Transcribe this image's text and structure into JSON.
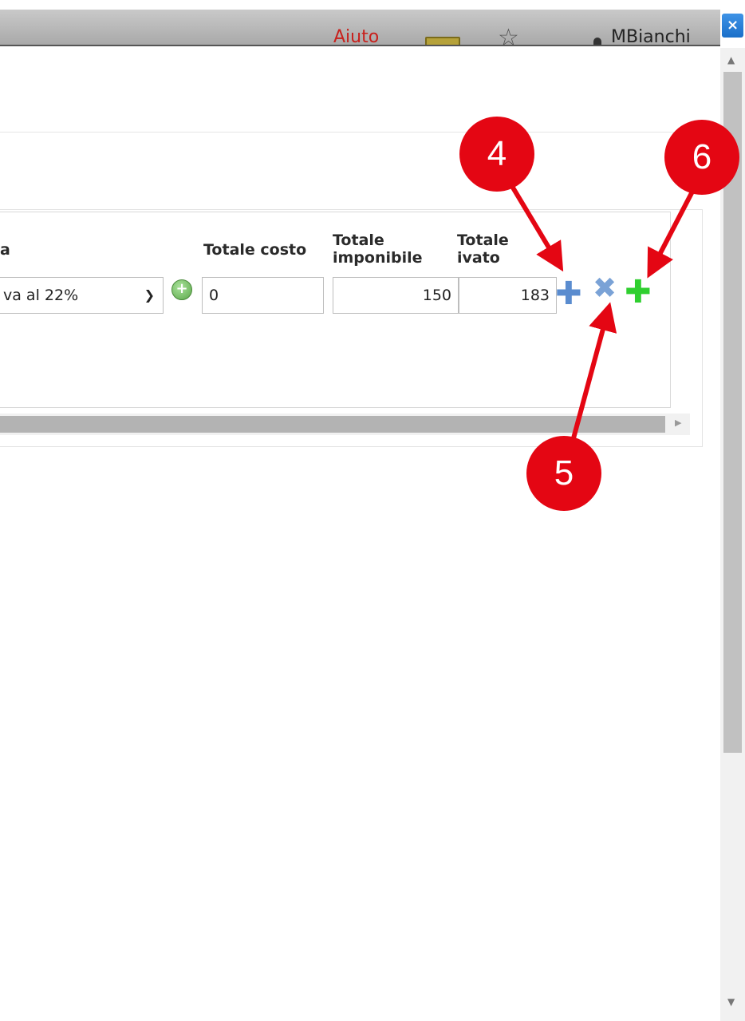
{
  "topbar": {
    "help_link": "Aiuto",
    "username": "MBianchi",
    "close_label": "×"
  },
  "table": {
    "headers": {
      "iva": "a",
      "totale_costo": "Totale costo",
      "totale_imponibile_line1": "Totale",
      "totale_imponibile_line2": "imponibile",
      "totale_ivato_line1": "Totale",
      "totale_ivato_line2": "ivato"
    },
    "row": {
      "iva_selected": "va al 22%",
      "totale_costo": "0",
      "totale_imponibile": "150",
      "totale_ivato": "183"
    }
  },
  "icons": {
    "add_iva": "plus-circle-icon",
    "add_row": "plus-icon",
    "remove_row": "x-icon",
    "add_new_row": "plus-green-icon",
    "select_chevron": "chevron-down-icon"
  },
  "callouts": {
    "c4": "4",
    "c5": "5",
    "c6": "6",
    "color": "#e40613"
  }
}
